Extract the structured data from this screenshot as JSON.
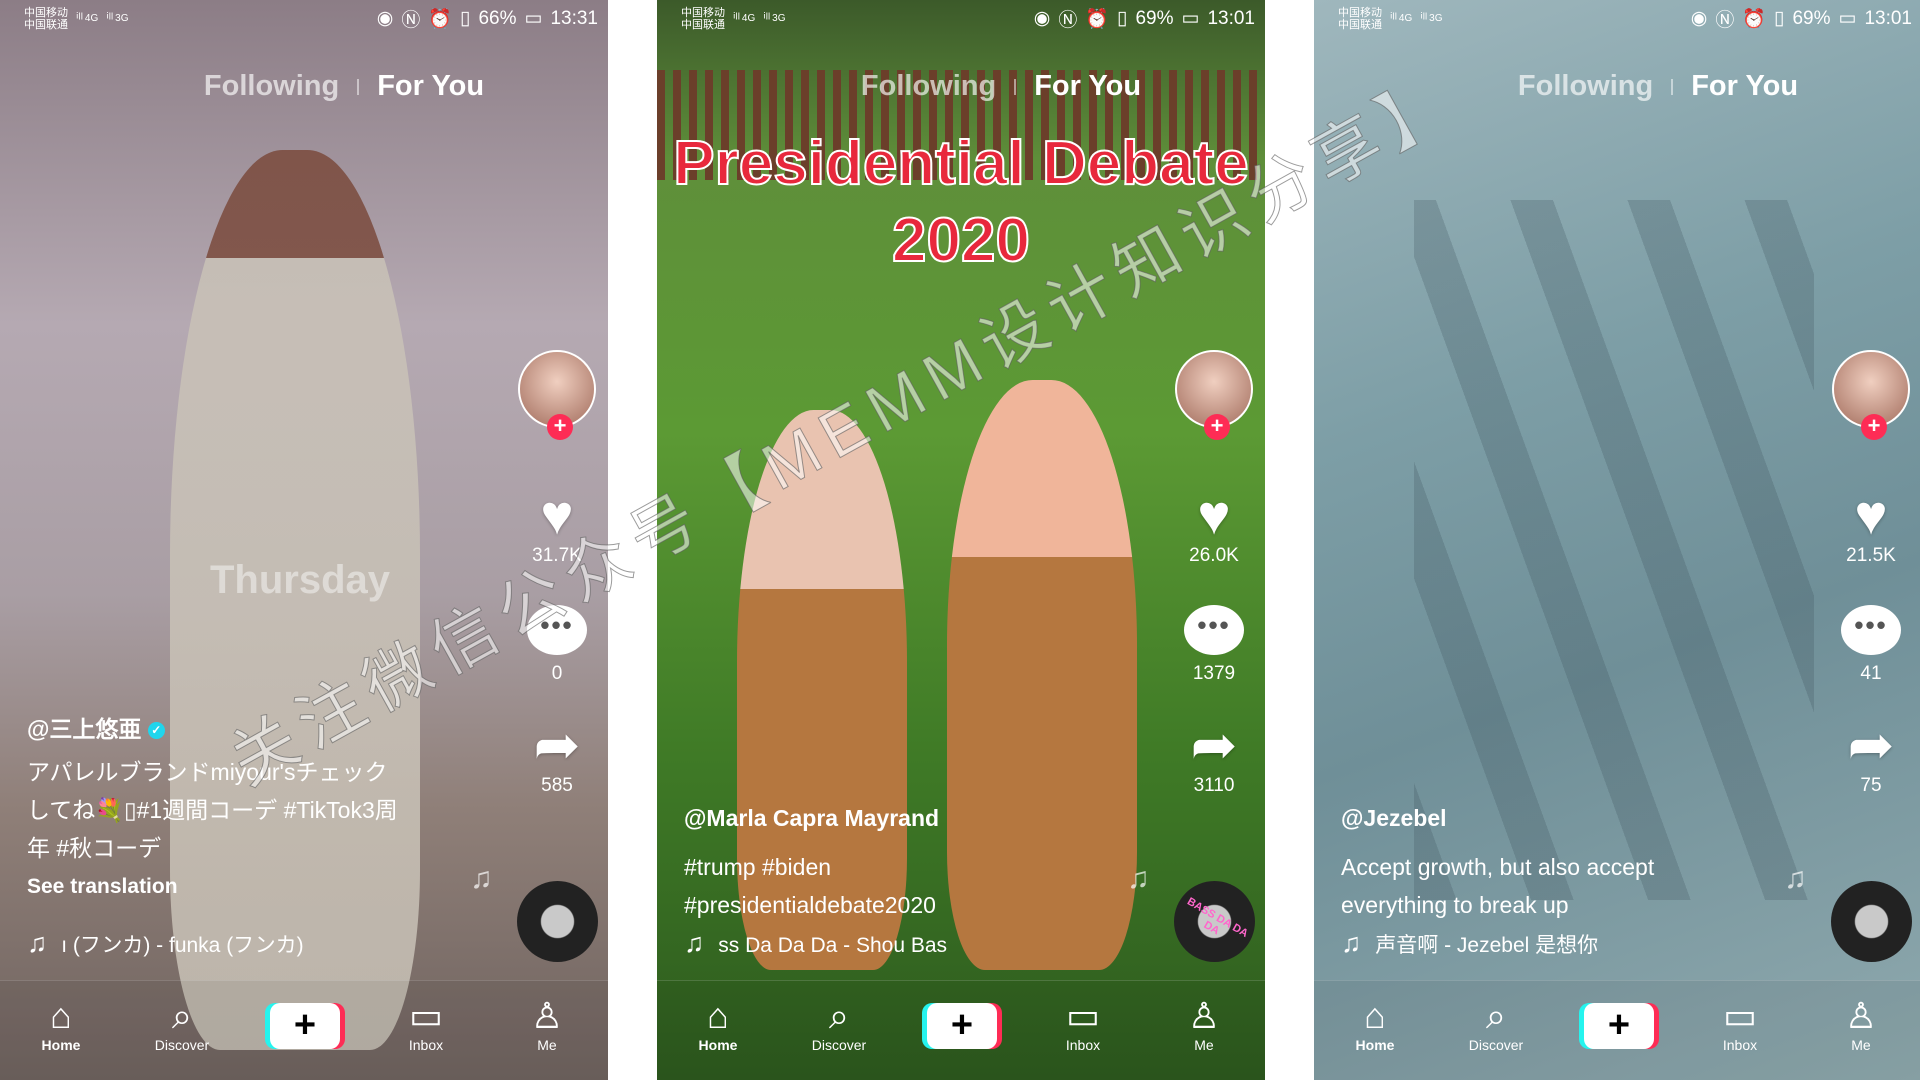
{
  "colors": {
    "accent": "#fe2c55",
    "cyan": "#25f4ee",
    "verified": "#20d5ec",
    "title_red": "#e8283c"
  },
  "icons": {
    "home": "home-icon",
    "discover": "search-icon",
    "create": "plus-icon",
    "inbox": "inbox-icon",
    "me": "person-icon",
    "like": "heart-icon",
    "comment": "comment-icon",
    "share": "share-icon",
    "music": "music-note-icon"
  },
  "watermark": "关注微信公众号【MEMM设计知识分享】",
  "panels": [
    {
      "status": {
        "carrier1": "中国移动",
        "carrier2": "中国联通",
        "net1": "4G",
        "net2": "3G",
        "battery": "66%",
        "time": "13:31"
      },
      "tabs": {
        "following": "Following",
        "for_you": "For You"
      },
      "overlay_text": "Thursday",
      "username": "@三上悠亜",
      "verified": true,
      "caption": [
        "アパレルブランドmiyour'sチェック",
        "してね💐▯#1週間コーデ #TikTok3周",
        "年 #秋コーデ"
      ],
      "see_translation": "See translation",
      "music": "ı (フンカ) - funka (フンカ)",
      "likes": "31.7K",
      "comments": "0",
      "shares": "585",
      "nav": [
        "Home",
        "Discover",
        "",
        "Inbox",
        "Me"
      ]
    },
    {
      "status": {
        "carrier1": "中国移动",
        "carrier2": "中国联通",
        "net1": "4G",
        "net2": "3G",
        "battery": "69%",
        "time": "13:01"
      },
      "tabs": {
        "following": "Following",
        "for_you": "For You"
      },
      "title_lines": [
        "Presidential Debate",
        "2020"
      ],
      "username": "@Marla Capra Mayrand",
      "verified": false,
      "caption": [
        "#trump #biden",
        "#presidentialdebate2020"
      ],
      "music": "ss Da Da Da - Shou    Bas",
      "disc_label": "BASS DA DA DA",
      "likes": "26.0K",
      "comments": "1379",
      "shares": "3110",
      "nav": [
        "Home",
        "Discover",
        "",
        "Inbox",
        "Me"
      ]
    },
    {
      "status": {
        "carrier1": "中国移动",
        "carrier2": "中国联通",
        "net1": "4G",
        "net2": "3G",
        "battery": "69%",
        "time": "13:01"
      },
      "tabs": {
        "following": "Following",
        "for_you": "For You"
      },
      "username": "@Jezebel",
      "verified": false,
      "caption": [
        "Accept growth, but also accept",
        "everything to break up"
      ],
      "music": "声音啊 - Jezebel    是想你",
      "likes": "21.5K",
      "comments": "41",
      "shares": "75",
      "nav": [
        "Home",
        "Discover",
        "",
        "Inbox",
        "Me"
      ]
    }
  ]
}
